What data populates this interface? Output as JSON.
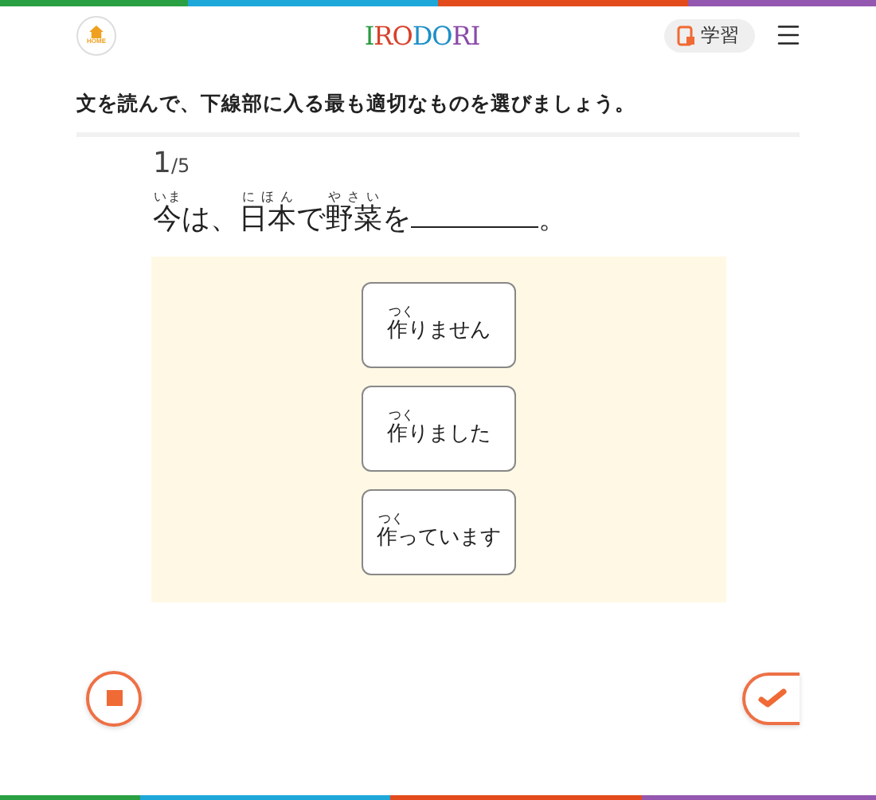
{
  "header": {
    "home_label": "HOME",
    "logo": "IRODORI",
    "study_button": "学習"
  },
  "instruction": "文を読んで、下線部に入る最も適切なものを選びましょう。",
  "progress": {
    "current": "1",
    "total": "/5"
  },
  "question": [
    {
      "text": "今",
      "ruby": "いま"
    },
    {
      "text": "は、"
    },
    {
      "text": "日本",
      "ruby": "にほん"
    },
    {
      "text": "で"
    },
    {
      "text": "野菜",
      "ruby": "やさい"
    },
    {
      "text": "を"
    },
    {
      "kind": "blank"
    },
    {
      "text": "。"
    }
  ],
  "choices": [
    {
      "ruby_base": "作",
      "ruby": "つく",
      "rest": "りません",
      "selected": false
    },
    {
      "ruby_base": "作",
      "ruby": "つく",
      "rest": "りました",
      "selected": false
    },
    {
      "ruby_base": "作",
      "ruby": "つく",
      "rest": "っています",
      "selected": false
    }
  ]
}
